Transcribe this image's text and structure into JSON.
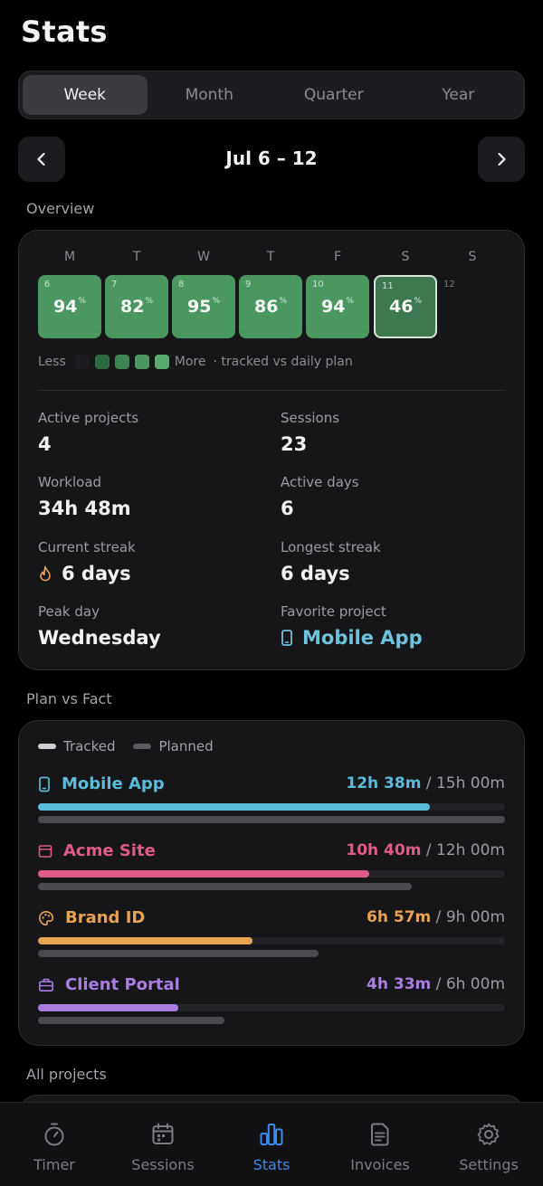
{
  "page": {
    "title": "Stats"
  },
  "periods": [
    {
      "label": "Week",
      "active": true
    },
    {
      "label": "Month",
      "active": false
    },
    {
      "label": "Quarter",
      "active": false
    },
    {
      "label": "Year",
      "active": false
    }
  ],
  "range": {
    "label": "Jul 6 – 12"
  },
  "overview": {
    "section_label": "Overview",
    "weekdays": [
      "M",
      "T",
      "W",
      "T",
      "F",
      "S",
      "S"
    ],
    "days": [
      {
        "num": "6",
        "value": "94",
        "unit": "%"
      },
      {
        "num": "7",
        "value": "82",
        "unit": "%"
      },
      {
        "num": "8",
        "value": "95",
        "unit": "%"
      },
      {
        "num": "9",
        "value": "86",
        "unit": "%"
      },
      {
        "num": "10",
        "value": "94",
        "unit": "%"
      },
      {
        "num": "11",
        "value": "46",
        "unit": "%",
        "selected": true
      },
      {
        "num": "12"
      }
    ],
    "legend": {
      "less": "Less",
      "more": "More",
      "note": "· tracked vs daily plan"
    },
    "legend_colors": [
      "#1c1c20",
      "#2f6b42",
      "#3d8552",
      "#4a9860",
      "#5aab70"
    ],
    "stats": [
      {
        "label": "Active projects",
        "value": "4"
      },
      {
        "label": "Sessions",
        "value": "23"
      },
      {
        "label": "Workload",
        "value": "34h 48m"
      },
      {
        "label": "Active days",
        "value": "6"
      },
      {
        "label": "Current streak",
        "value": "6 days",
        "icon": "flame-icon"
      },
      {
        "label": "Longest streak",
        "value": "6 days"
      },
      {
        "label": "Peak day",
        "value": "Wednesday"
      },
      {
        "label": "Favorite project",
        "value": "Mobile App",
        "icon": "phone-icon"
      }
    ]
  },
  "plan_vs_fact": {
    "section_label": "Plan vs Fact",
    "legend": {
      "tracked": "Tracked",
      "planned": "Planned"
    },
    "projects": [
      {
        "name": "Mobile App",
        "tracked": "12h 38m",
        "planned": "15h 00m",
        "color": "#5bbcd8",
        "icon": "phone-icon",
        "tracked_fraction": 0.84,
        "planned_fraction": 1.0
      },
      {
        "name": "Acme Site",
        "tracked": "10h 40m",
        "planned": "12h 00m",
        "color": "#e05a8a",
        "icon": "browser-icon",
        "tracked_fraction": 0.71,
        "planned_fraction": 0.8
      },
      {
        "name": "Brand ID",
        "tracked": "6h 57m",
        "planned": "9h 00m",
        "color": "#e8a253",
        "icon": "palette-icon",
        "tracked_fraction": 0.46,
        "planned_fraction": 0.6
      },
      {
        "name": "Client Portal",
        "tracked": "4h 33m",
        "planned": "6h 00m",
        "color": "#a87ee0",
        "icon": "briefcase-icon",
        "tracked_fraction": 0.3,
        "planned_fraction": 0.4
      }
    ]
  },
  "all_projects": {
    "section_label": "All projects"
  },
  "tabs": [
    {
      "label": "Timer",
      "icon": "stopwatch-icon",
      "active": false
    },
    {
      "label": "Sessions",
      "icon": "calendar-icon",
      "active": false
    },
    {
      "label": "Stats",
      "icon": "bar-chart-icon",
      "active": true
    },
    {
      "label": "Invoices",
      "icon": "document-icon",
      "active": false
    },
    {
      "label": "Settings",
      "icon": "gear-icon",
      "active": false
    }
  ]
}
